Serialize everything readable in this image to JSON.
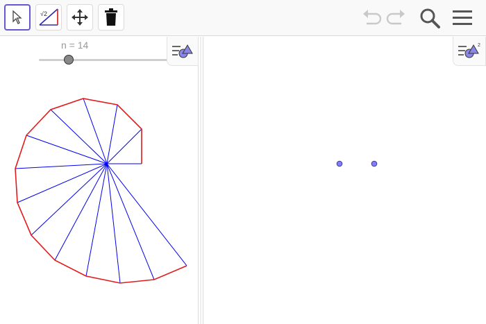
{
  "toolbar": {
    "tools": [
      {
        "name": "move-tool",
        "selected": true
      },
      {
        "name": "square-root-segment-tool",
        "selected": false,
        "text": "√2"
      },
      {
        "name": "move-graphics-view-tool",
        "selected": false
      },
      {
        "name": "delete-tool",
        "selected": false
      }
    ],
    "right_icons": [
      "undo-icon",
      "redo-icon",
      "search-icon",
      "menu-icon"
    ]
  },
  "graphics_left": {
    "slider": {
      "label": "n = 14",
      "value": 14
    },
    "style_bar_icon": "style-bar-icon"
  },
  "graphics_right": {
    "style_bar_icon": "style-bar-3d-icon",
    "style_bar_superscript": "2"
  },
  "colors": {
    "accent": "#6557d2",
    "outer_edges": "#e31a1c",
    "spokes": "#0000ee",
    "point_fill": "#7f7fff",
    "point_stroke": "#3a3a8c"
  }
}
